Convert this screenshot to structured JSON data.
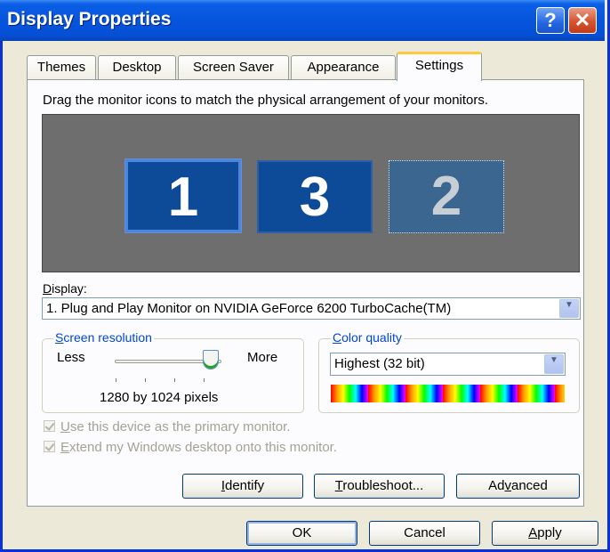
{
  "window": {
    "title": "Display Properties",
    "help_glyph": "?",
    "close_glyph": "✕"
  },
  "tabs": [
    {
      "label": "Themes"
    },
    {
      "label": "Desktop"
    },
    {
      "label": "Screen Saver"
    },
    {
      "label": "Appearance"
    },
    {
      "label": "Settings",
      "active": true
    }
  ],
  "settings": {
    "instruction": "Drag the monitor icons to match the physical arrangement of your monitors.",
    "monitors": [
      {
        "label": "1",
        "selected": true
      },
      {
        "label": "3"
      },
      {
        "label": "2",
        "inactive": true
      }
    ],
    "display_label_accel": "D",
    "display_label_rest": "isplay:",
    "display_value": "1. Plug and Play Monitor on NVIDIA GeForce 6200 TurboCache(TM)",
    "resolution": {
      "title_accel": "S",
      "title_rest": "creen resolution",
      "less": "Less",
      "more": "More",
      "value": "1280 by 1024 pixels",
      "slider_level": 0.82
    },
    "color_quality": {
      "title_accel": "C",
      "title_rest": "olor quality",
      "value": "Highest (32 bit)"
    },
    "checkboxes": [
      {
        "accel": "U",
        "rest": "se this device as the primary monitor.",
        "checked": true,
        "disabled": true
      },
      {
        "accel": "E",
        "rest": "xtend my Windows desktop onto this monitor.",
        "checked": true,
        "disabled": true
      }
    ],
    "buttons": {
      "identify_pre": "",
      "identify_accel": "I",
      "identify_post": "dentify",
      "troubleshoot_pre": "",
      "troubleshoot_accel": "T",
      "troubleshoot_post": "roubleshoot...",
      "advanced_pre": "Ad",
      "advanced_accel": "v",
      "advanced_post": "anced"
    }
  },
  "footer": {
    "ok": "OK",
    "cancel": "Cancel",
    "apply_accel": "A",
    "apply_rest": "pply"
  },
  "colors": {
    "titlebar": "#0654dd",
    "monitor_selected": "#0d4a98",
    "dialog_bg": "#ece9d8"
  }
}
